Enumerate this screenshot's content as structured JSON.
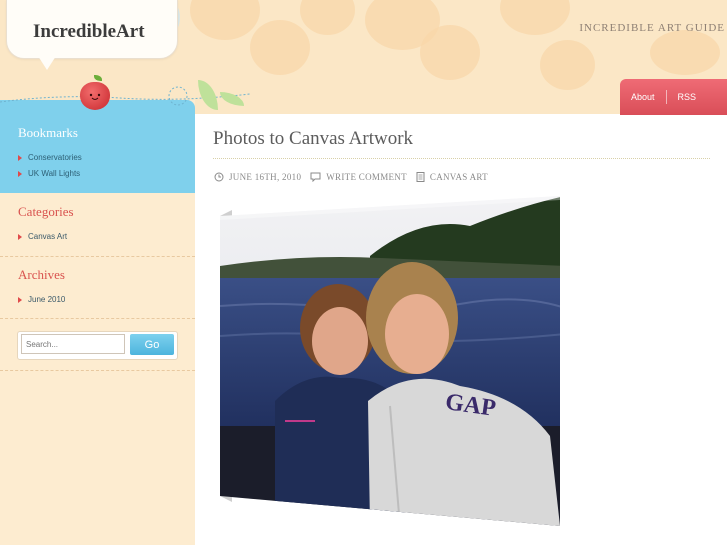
{
  "site": {
    "logo": "IncredibleArt",
    "tagline": "INCREDIBLE ART GUIDE"
  },
  "nav": {
    "items": [
      "About",
      "RSS"
    ]
  },
  "sidebar": {
    "bookmarks": {
      "title": "Bookmarks",
      "items": [
        "Conservatories",
        "UK Wall Lights"
      ]
    },
    "categories": {
      "title": "Categories",
      "items": [
        "Canvas Art"
      ]
    },
    "archives": {
      "title": "Archives",
      "items": [
        "June 2010"
      ]
    },
    "search": {
      "placeholder": "Search...",
      "button": "Go"
    }
  },
  "post": {
    "title": "Photos to Canvas Artwork",
    "date": "JUNE 16TH, 2010",
    "comment": "WRITE COMMENT",
    "category": "CANVAS ART",
    "hoodie_text": "GAP"
  },
  "colors": {
    "header_bg": "#fbe7c6",
    "sidebar_blue": "#7fd0ec",
    "nav_red": "#e05a63",
    "sidebar_cream": "#fdecd0"
  }
}
